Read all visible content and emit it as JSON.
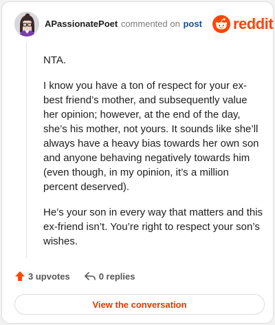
{
  "header": {
    "username": "APassionatePoet",
    "action_text": "commented on",
    "post_link": "post",
    "brand_name": "reddit"
  },
  "comment": {
    "paragraphs": [
      "NTA.",
      "I know you have a ton of respect for your ex-best friend’s mother, and subsequently value her opinion; however, at the end of the day, she’s his mother, not yours. It sounds like she’ll always have a heavy bias towards her own son and anyone behaving negatively towards him (even though, in my opinion, it’s a million percent deserved).",
      "He’s your son in every way that matters and this ex-friend isn’t. You’re right to respect your son’s wishes."
    ]
  },
  "footer": {
    "upvotes_label": "3 upvotes",
    "replies_label": "0 replies"
  },
  "actions": {
    "view_conversation_label": "View the conversation"
  },
  "colors": {
    "brand": "#ff4500",
    "link": "#0f4f9f",
    "button_text": "#d93a00"
  },
  "icons": {
    "avatar": "avatar-icon",
    "brand": "reddit-snoo-icon",
    "upvote": "upvote-arrow-icon",
    "reply": "reply-arrow-icon"
  }
}
